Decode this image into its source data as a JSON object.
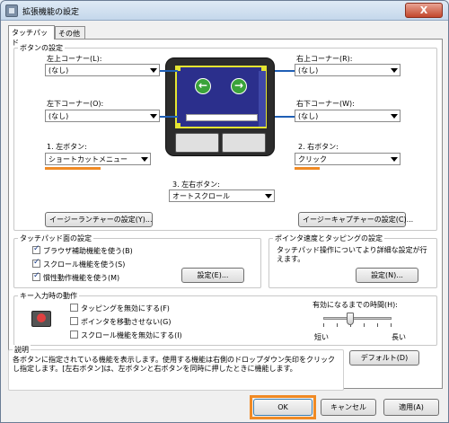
{
  "window": {
    "title": "拡張機能の設定",
    "close_glyph": "X"
  },
  "tabs": [
    {
      "label": "タッチパッド"
    },
    {
      "label": "その他"
    }
  ],
  "button_settings": {
    "legend": "ボタンの設定",
    "top_left": {
      "label": "左上コーナー(L):",
      "value": "(なし)"
    },
    "top_right": {
      "label": "右上コーナー(R):",
      "value": "(なし)"
    },
    "bottom_left": {
      "label": "左下コーナー(O):",
      "value": "(なし)"
    },
    "bottom_right": {
      "label": "右下コーナー(W):",
      "value": "(なし)"
    },
    "left_button": {
      "label": "1. 左ボタン:",
      "value": "ショートカットメニュー"
    },
    "right_button": {
      "label": "2. 右ボタン:",
      "value": "クリック"
    },
    "both_buttons": {
      "label": "3. 左右ボタン:",
      "value": "オートスクロール"
    },
    "easy_launcher_btn": "イージーランチャーの設定(Y)...",
    "easy_capture_btn": "イージーキャプチャーの設定(C)..."
  },
  "touchpad_surface": {
    "legend": "タッチパッド面の設定",
    "options": [
      {
        "label": "ブラウザ補助機能を使う(B)",
        "checked": true
      },
      {
        "label": "スクロール機能を使う(S)",
        "checked": true
      },
      {
        "label": "慣性動作機能を使う(M)",
        "checked": true
      }
    ],
    "settings_btn": "設定(E)..."
  },
  "pointer_speed": {
    "legend": "ポインタ速度とタッピングの設定",
    "description": "タッチパッド操作についてより詳細な設定が行えます。",
    "settings_btn": "設定(N)..."
  },
  "key_input": {
    "legend": "キー入力時の動作",
    "options": [
      {
        "label": "タッピングを無効にする(F)",
        "checked": false
      },
      {
        "label": "ポインタを移動させない(G)",
        "checked": false
      },
      {
        "label": "スクロール機能を無効にする(I)",
        "checked": false
      }
    ],
    "timeout_label": "有効になるまでの時間(H):",
    "short_label": "短い",
    "long_label": "長い",
    "slider_value_fraction": 0.38
  },
  "description": {
    "legend": "説明",
    "text": "各ボタンに指定されている機能を表示します。使用する機能は右側のドロップダウン矢印をクリックし指定します。[左右ボタン]は、左ボタンと右ボタンを同時に押したときに機能します。",
    "default_btn": "デフォルト(D)"
  },
  "footer": {
    "ok": "OK",
    "cancel": "キャンセル",
    "apply": "適用(A)"
  },
  "colors": {
    "highlight": "#f08a24",
    "connector": "#1f5fb5",
    "pad_surface": "#2b2f8c",
    "pad_border": "#e5e532"
  }
}
